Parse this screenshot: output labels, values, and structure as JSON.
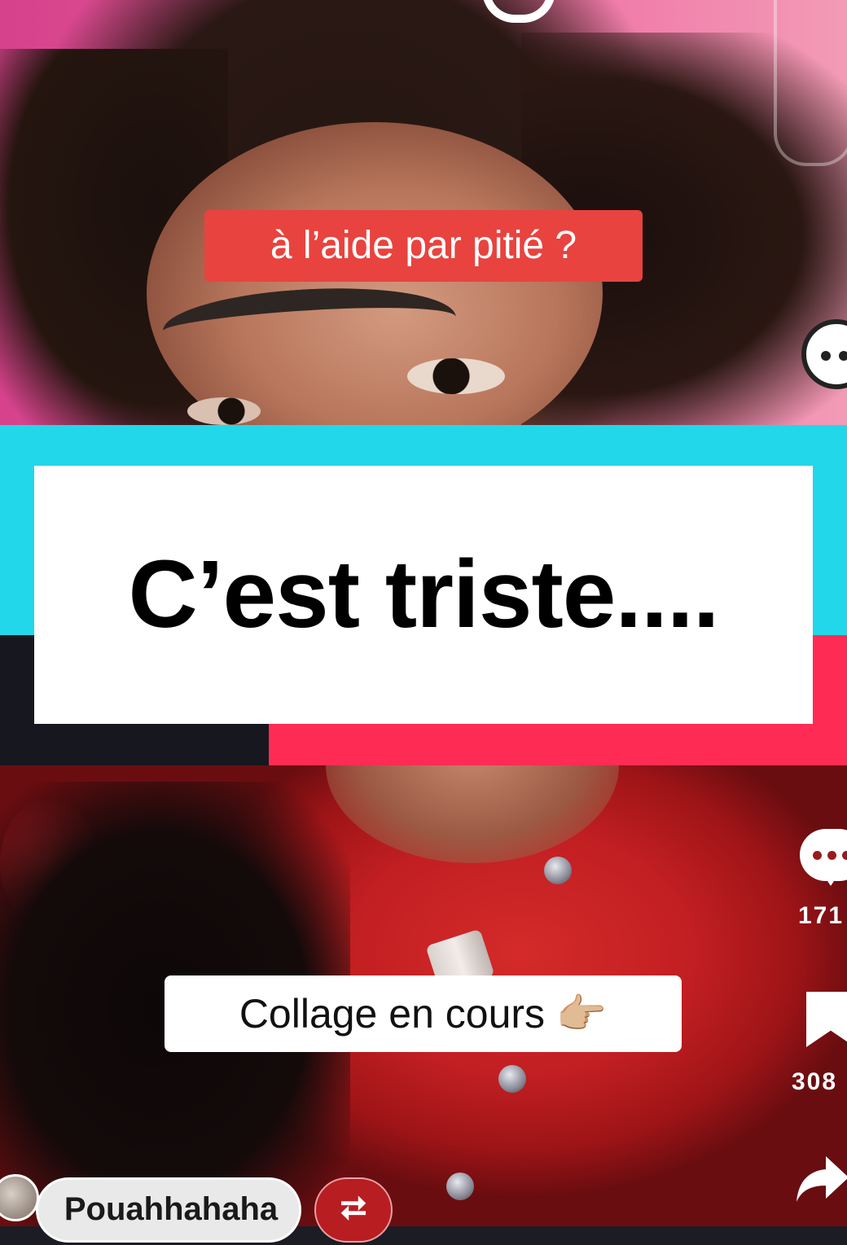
{
  "top_video": {
    "caption": "à l’aide par pitié ?",
    "more_icon": "more-options-icon"
  },
  "title_card": {
    "text": "C’est triste....",
    "colors": {
      "cyan": "#22d7ea",
      "pink": "#fe2c55",
      "dark": "#17171f"
    }
  },
  "bottom_video": {
    "caption": "Collage en cours 👉🏼",
    "comments": {
      "icon": "comment-icon",
      "count": "171"
    },
    "saves": {
      "icon": "bookmark-icon",
      "count": "308"
    },
    "share": {
      "icon": "share-icon"
    },
    "user": {
      "name": "Pouahhahaha",
      "avatar_icon": "avatar"
    },
    "repost": {
      "icon": "repost-icon",
      "glyph": "⮂"
    }
  }
}
